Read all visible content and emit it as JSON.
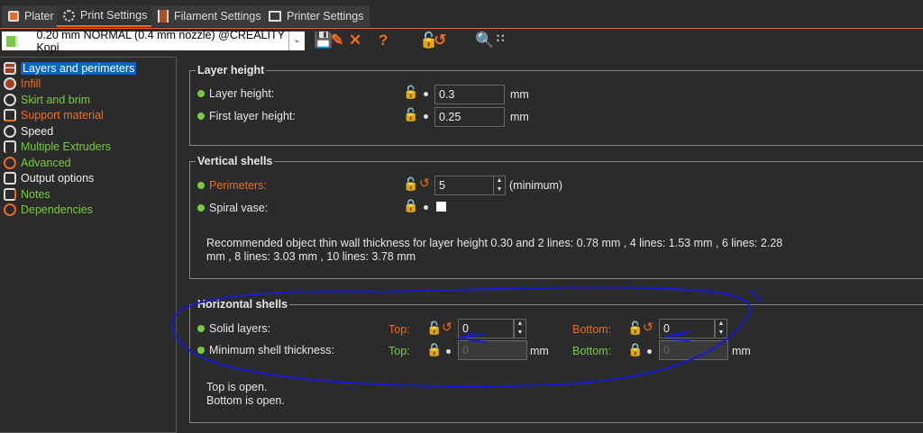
{
  "tabs": [
    {
      "label": "Plater"
    },
    {
      "label": "Print Settings"
    },
    {
      "label": "Filament Settings"
    },
    {
      "label": "Printer Settings"
    }
  ],
  "preset": {
    "value": "0.20 mm NORMAL (0.4 mm nozzle) @CREALITY - Kopi"
  },
  "sidebar": {
    "items": [
      {
        "label": "Layers and perimeters"
      },
      {
        "label": "Infill"
      },
      {
        "label": "Skirt and brim"
      },
      {
        "label": "Support material"
      },
      {
        "label": "Speed"
      },
      {
        "label": "Multiple Extruders"
      },
      {
        "label": "Advanced"
      },
      {
        "label": "Output options"
      },
      {
        "label": "Notes"
      },
      {
        "label": "Dependencies"
      }
    ]
  },
  "layer_height": {
    "title": "Layer height",
    "layer_height_label": "Layer height:",
    "layer_height": "0.3",
    "first_layer_label": "First layer height:",
    "first_layer": "0.25",
    "unit": "mm"
  },
  "vertical_shells": {
    "title": "Vertical shells",
    "perimeters_label": "Perimeters:",
    "perimeters": "5",
    "perimeters_suffix": "(minimum)",
    "spiral_label": "Spiral vase:",
    "note_line1": "Recommended object thin wall thickness for layer height 0.30 and 2 lines: 0.78 mm , 4 lines: 1.53 mm , 6 lines: 2.28",
    "note_line2": "mm , 8 lines: 3.03 mm , 10 lines: 3.78 mm"
  },
  "horizontal_shells": {
    "title": "Horizontal shells",
    "solid_label": "Solid layers:",
    "top_label": "Top:",
    "bottom_label": "Bottom:",
    "solid_top": "0",
    "solid_bottom": "0",
    "min_label": "Minimum shell thickness:",
    "min_top": "0",
    "min_bottom": "0",
    "unit": "mm",
    "status1": "Top is open.",
    "status2": "Bottom is open."
  },
  "colors": {
    "accent": "#ed6b21",
    "green": "#7ac943",
    "annotation": "#1a1ad0"
  }
}
